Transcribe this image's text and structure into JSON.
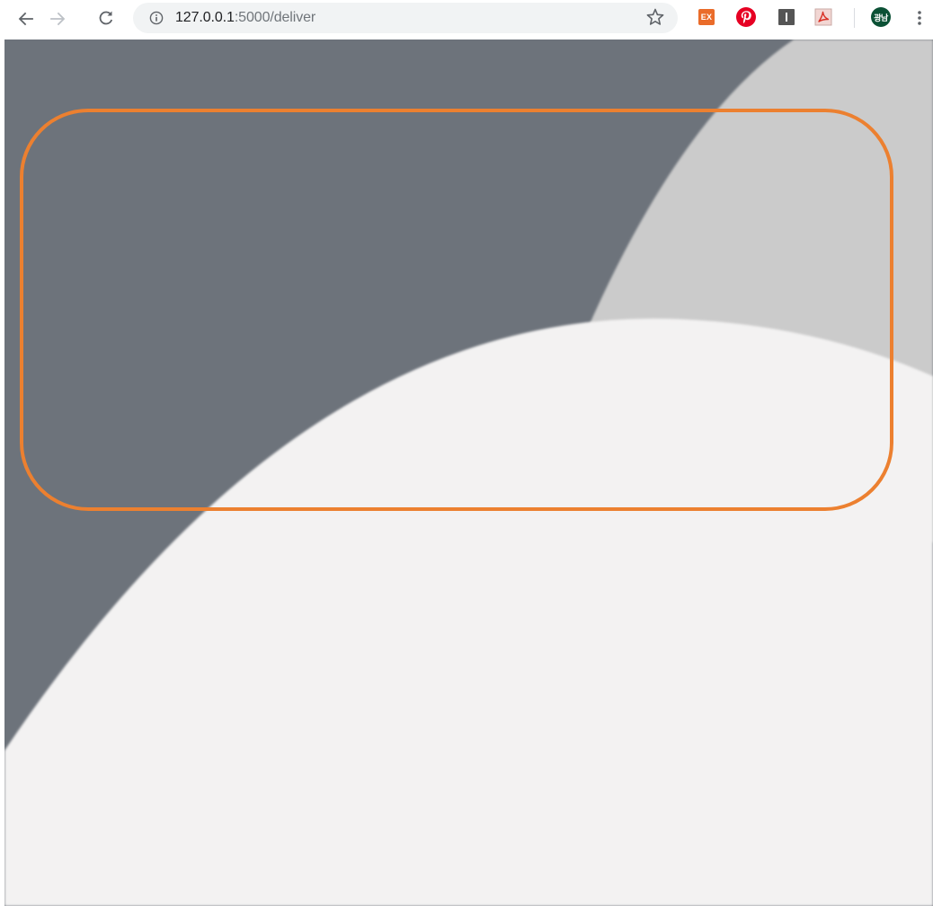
{
  "browser": {
    "url_host": "127.0.0.1",
    "url_path": ":5000/deliver",
    "profile_initials": "광남",
    "extensions": [
      {
        "name": "ex-extension",
        "label": "EX",
        "color": "#ea6c2a"
      },
      {
        "name": "pinterest-extension",
        "color": "#e60023"
      },
      {
        "name": "instapaper-extension",
        "label": "I",
        "color": "#555555"
      },
      {
        "name": "acrobat-extension",
        "color": "#d93025"
      }
    ],
    "icons": {
      "back": "arrow-left-icon",
      "forward": "arrow-right-icon",
      "reload": "reload-icon",
      "site_info": "info-icon",
      "bookmark": "star-icon",
      "menu": "kebab-menu-icon"
    }
  },
  "page": {
    "colors": {
      "background_dark": "#6d737b",
      "background_mid": "#cbcbcb",
      "background_light": "#f3f2f2",
      "highlight_border": "#ec8030"
    }
  }
}
